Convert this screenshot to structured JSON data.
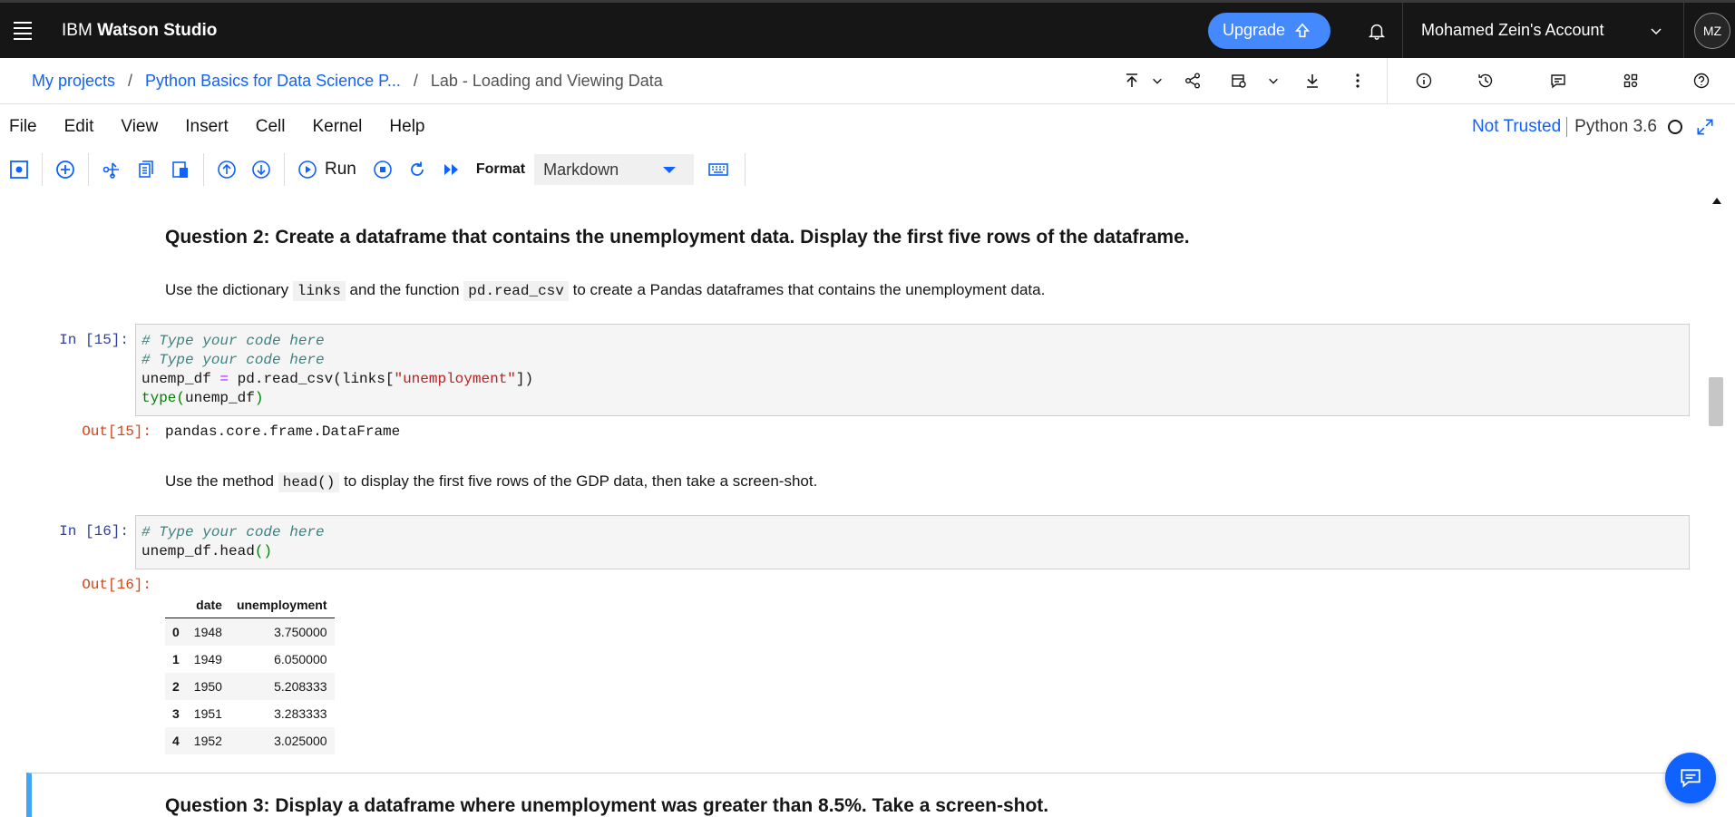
{
  "app": {
    "brand_prefix": "IBM ",
    "brand_name": "Watson Studio"
  },
  "header": {
    "upgrade_label": "Upgrade",
    "account_name": "Mohamed Zein's Account",
    "avatar_initials": "MZ"
  },
  "breadcrumb": {
    "root": "My projects",
    "project": "Python Basics for Data Science P...",
    "sep": "/",
    "current": "Lab - Loading and Viewing Data"
  },
  "menu": {
    "items": [
      "File",
      "Edit",
      "View",
      "Insert",
      "Cell",
      "Kernel",
      "Help"
    ],
    "trust_status": "Not Trusted",
    "kernel": "Python 3.6"
  },
  "toolbar": {
    "run_label": "Run",
    "format_label": "Format",
    "format_value": "Markdown"
  },
  "notebook": {
    "q2_title": "Question 2: Create a dataframe that contains the unemployment data. Display the first five rows of the dataframe.",
    "q2_text": {
      "part1": "Use the dictionary ",
      "code1": "links",
      "part2": " and the function ",
      "code2": "pd.read_csv",
      "part3": " to create a Pandas dataframes that contains the unemployment data."
    },
    "cell15": {
      "in_prompt": "In [15]:",
      "line1": "# Type your code here",
      "line2": "# Type your code here",
      "line3_a": "unemp_df ",
      "line3_op": "=",
      "line3_b": " pd.read_csv(links[",
      "line3_str": "\"unemployment\"",
      "line3_c": "])",
      "line4_fn": "type(",
      "line4_b": "unemp_df",
      "line4_c": ")",
      "out_prompt": "Out[15]:",
      "output": "pandas.core.frame.DataFrame"
    },
    "head_text": {
      "part1": "Use the method ",
      "code": "head()",
      "part2": " to display the first five rows of the GDP data, then take a screen-shot."
    },
    "cell16": {
      "in_prompt": "In [16]:",
      "line1": "# Type your code here",
      "line2_a": "unemp_df.head",
      "line2_b": "()",
      "out_prompt": "Out[16]:"
    },
    "table": {
      "columns": [
        "",
        "date",
        "unemployment"
      ],
      "rows": [
        [
          "0",
          "1948",
          "3.750000"
        ],
        [
          "1",
          "1949",
          "6.050000"
        ],
        [
          "2",
          "1950",
          "5.208333"
        ],
        [
          "3",
          "1951",
          "3.283333"
        ],
        [
          "4",
          "1952",
          "3.025000"
        ]
      ]
    },
    "q3_title": "Question 3: Display a dataframe where unemployment was greater than 8.5%. Take a screen-shot."
  },
  "colors": {
    "topbar": "#161616",
    "accent": "#0f62fe",
    "upgrade": "#4589ff",
    "selected_cell": "#42a5f5"
  }
}
